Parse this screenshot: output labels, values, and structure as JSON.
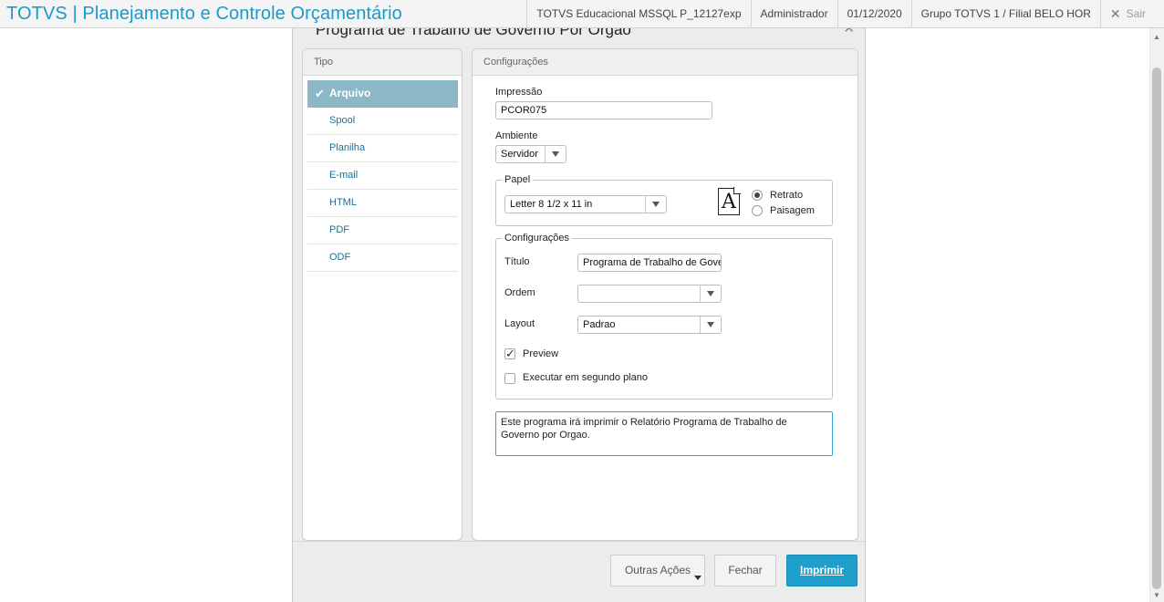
{
  "topbar": {
    "app_title": "TOTVS | Planejamento e Controle Orçamentário",
    "environment": "TOTVS Educacional MSSQL P_12127exp",
    "user": "Administrador",
    "date": "01/12/2020",
    "branch": "Grupo TOTVS 1 / Filial BELO HOR",
    "exit_label": "Sair"
  },
  "dialog": {
    "title": "Programa de Trabalho de Governo Por Orgao",
    "tipo": {
      "header": "Tipo",
      "items": [
        {
          "label": "Arquivo",
          "active": true
        },
        {
          "label": "Spool",
          "active": false
        },
        {
          "label": "Planilha",
          "active": false
        },
        {
          "label": "E-mail",
          "active": false
        },
        {
          "label": "HTML",
          "active": false
        },
        {
          "label": "PDF",
          "active": false
        },
        {
          "label": "ODF",
          "active": false
        }
      ]
    },
    "config": {
      "header": "Configurações",
      "impressao_label": "Impressão",
      "impressao_value": "PCOR075",
      "ambiente_label": "Ambiente",
      "ambiente_value": "Servidor",
      "papel": {
        "legend": "Papel",
        "paper_value": "Letter 8 1/2 x 11 in",
        "orientation_icon_letter": "A",
        "retrato_label": "Retrato",
        "paisagem_label": "Paisagem",
        "selected_orientation": "Retrato"
      },
      "settings": {
        "legend": "Configurações",
        "titulo_label": "Título",
        "titulo_value": "Programa de Trabalho de Gove",
        "ordem_label": "Ordem",
        "ordem_value": "",
        "layout_label": "Layout",
        "layout_value": "Padrao",
        "preview_label": "Preview",
        "preview_checked": true,
        "background_label": "Executar em segundo plano",
        "background_checked": false
      },
      "description": "Este programa irá imprimir o Relatório Programa de Trabalho de Governo por Orgao."
    },
    "buttons": {
      "other_actions": "Outras Ações",
      "close": "Fechar",
      "print": "Imprimir"
    }
  },
  "icons": {
    "check": "checkmark-icon",
    "close": "close-icon",
    "dropdown": "chevron-down-icon",
    "document": "document-portrait-icon"
  },
  "colors": {
    "brand": "#1b9ac7",
    "active_tab": "#8bb7c7",
    "primary_button": "#1f9fcb",
    "link": "#1b6f96"
  }
}
